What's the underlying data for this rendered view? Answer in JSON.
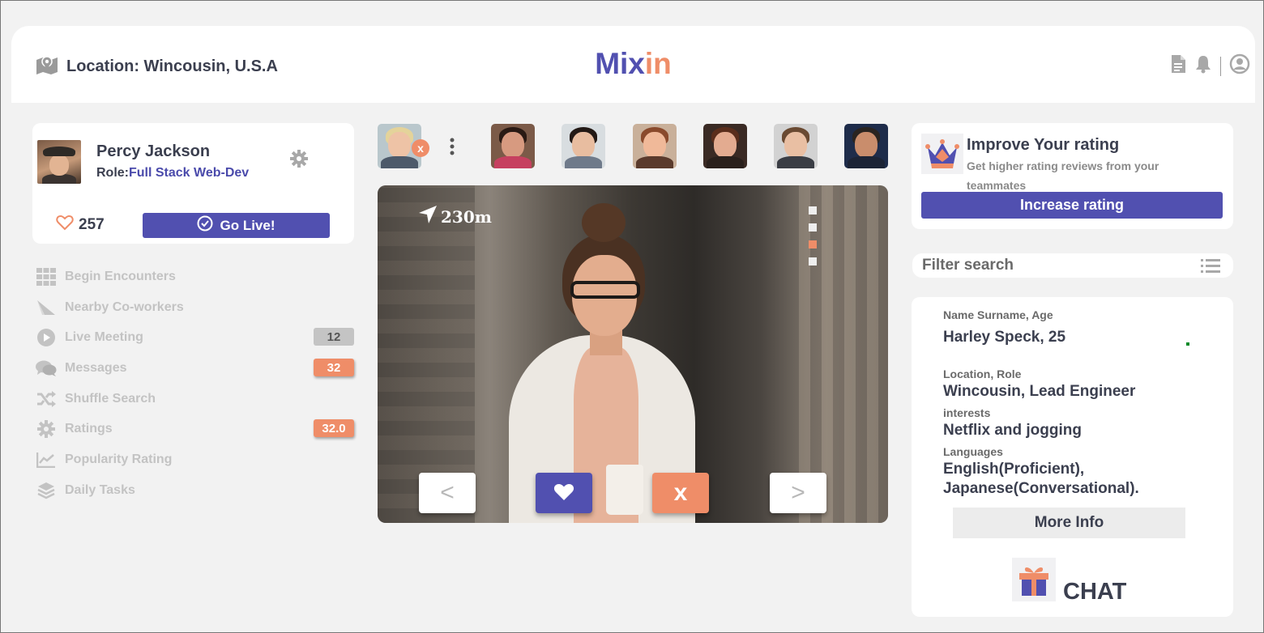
{
  "header": {
    "location_text": "Location: Wincousin, U.S.A",
    "brand_part1": "Mix",
    "brand_part2": "in"
  },
  "profile": {
    "name": "Percy Jackson",
    "role_label": "Role:",
    "role_value": "Full Stack Web-Dev",
    "likes": "257",
    "go_live_label": "Go Live!"
  },
  "menu": {
    "items": [
      {
        "label": "Begin Encounters",
        "icon": "grid-icon"
      },
      {
        "label": "Nearby Co-workers",
        "icon": "send-icon"
      },
      {
        "label": "Live Meeting",
        "icon": "play-icon",
        "badge": "12"
      },
      {
        "label": "Messages",
        "icon": "chat-bubbles-icon",
        "badge": "32"
      },
      {
        "label": "Shuffle Search",
        "icon": "shuffle-icon"
      },
      {
        "label": "Ratings",
        "icon": "gear-icon",
        "badge": "32.0"
      },
      {
        "label": "Popularity Rating",
        "icon": "chart-icon"
      },
      {
        "label": "Daily Tasks",
        "icon": "layers-icon"
      }
    ]
  },
  "stories": {
    "close_label": "x"
  },
  "card": {
    "distance": "230m",
    "prev_label": "<",
    "next_label": ">",
    "nope_label": "x",
    "photo_index": 3,
    "photo_count": 4
  },
  "rating": {
    "title": "Improve Your rating",
    "subtitle": "Get higher rating reviews from your teammates",
    "button_label": "Increase rating"
  },
  "filter": {
    "placeholder": "Filter search"
  },
  "info": {
    "name_label": "Name Surname, Age",
    "name_value": "Harley Speck, 25",
    "location_label": "Location, Role",
    "location_value": "Wincousin, Lead Engineer",
    "interests_label": "interests",
    "interests_value": "Netflix and jogging",
    "languages_label": "Languages",
    "languages_value_1": "English(Proficient),",
    "languages_value_2": "Japanese(Conversational).",
    "more_info_label": "More Info",
    "chat_label": "CHAT"
  },
  "colors": {
    "accent_purple": "#5150b0",
    "accent_orange": "#ef8d68",
    "background": "#f2f2f2"
  }
}
